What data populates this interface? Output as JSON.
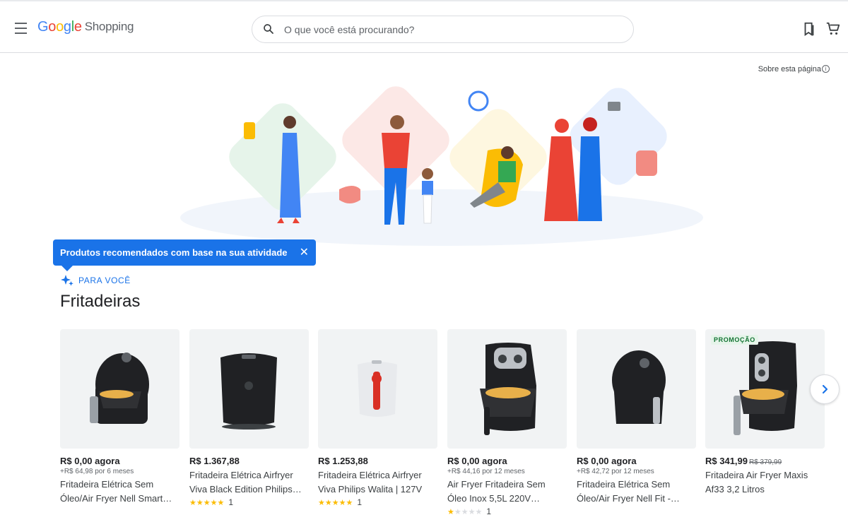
{
  "header": {
    "logo": {
      "g": "G",
      "o1": "o",
      "o2": "o",
      "g2": "g",
      "l": "l",
      "e": "e",
      "product": "Shopping"
    },
    "search_placeholder": "O que você está procurando?"
  },
  "about_page": "Sobre esta página",
  "banner": {
    "text": "Produtos recomendados com base na sua atividade",
    "close": "✕"
  },
  "section": {
    "eyebrow": "PARA VOCÊ",
    "title": "Fritadeiras"
  },
  "products": [
    {
      "price": "R$ 0,00 agora",
      "sub_price": "+R$ 64,98 por 6 meses",
      "title_l1": "Fritadeira Elétrica Sem",
      "title_l2": "Óleo/Air Fryer Nell Smart…",
      "stars": 0,
      "rating_count": "",
      "color": "#202124"
    },
    {
      "price": "R$ 1.367,88",
      "sub_price": "",
      "title_l1": "Fritadeira Elétrica Airfryer",
      "title_l2": "Viva Black Edition Philips…",
      "stars": 5,
      "rating_count": "1",
      "color": "#202124"
    },
    {
      "price": "R$ 1.253,88",
      "sub_price": "",
      "title_l1": "Fritadeira Elétrica Airfryer",
      "title_l2": "Viva Philips Walita | 127V",
      "stars": 5,
      "rating_count": "1",
      "color": "#e8eaed"
    },
    {
      "price": "R$ 0,00 agora",
      "sub_price": "+R$ 44,16 por 12 meses",
      "title_l1": "Air Fryer Fritadeira Sem",
      "title_l2": "Óleo Inox 5,5L 220V…",
      "stars": 1,
      "rating_count": "1",
      "color": "#202124"
    },
    {
      "price": "R$ 0,00 agora",
      "sub_price": "+R$ 42,72 por 12 meses",
      "title_l1": "Fritadeira Elétrica Sem",
      "title_l2": "Óleo/Air Fryer Nell Fit -…",
      "stars": 0,
      "rating_count": "",
      "color": "#202124"
    },
    {
      "price": "R$ 341,99",
      "old_price": "R$ 379,99",
      "badge": "PROMOÇÃO",
      "sub_price": "",
      "title_l1": "Fritadeira Air Fryer Maxis",
      "title_l2": "Af33 3,2 Litros",
      "stars": 0,
      "rating_count": "",
      "color": "#202124"
    }
  ]
}
